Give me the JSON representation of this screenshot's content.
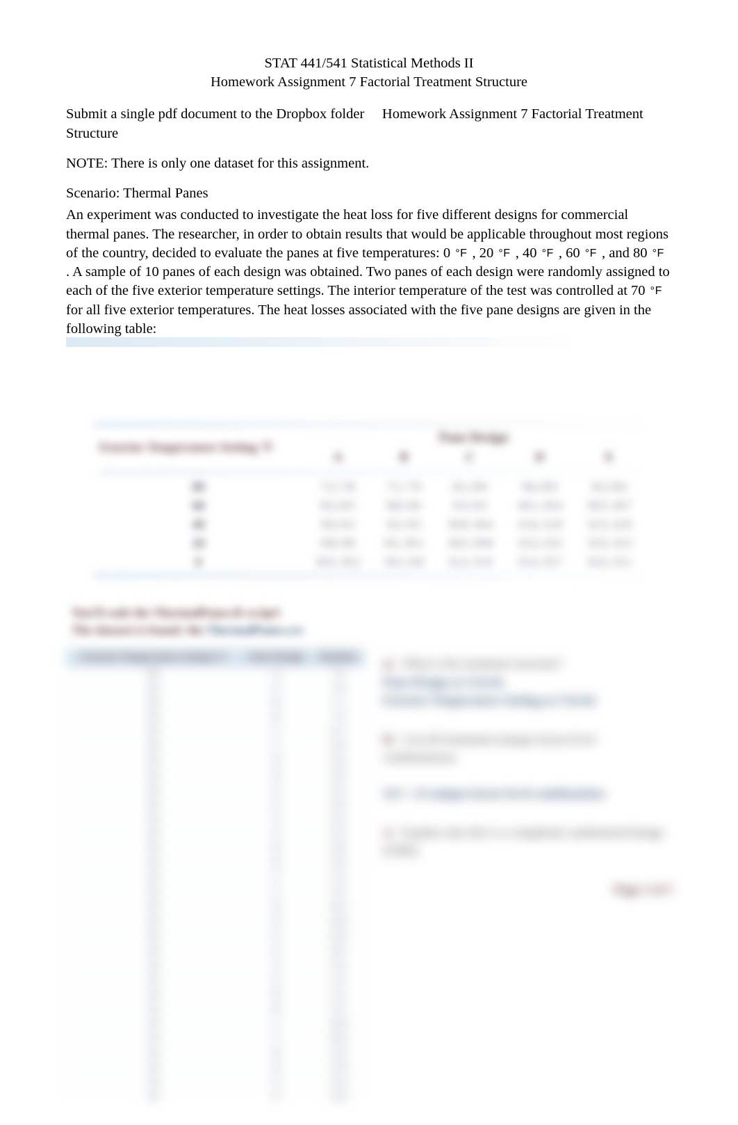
{
  "header": {
    "line1": "STAT 441/541 Statistical Methods II",
    "line2": "Homework Assignment 7 Factorial Treatment Structure"
  },
  "submit_para": {
    "prefix": "Submit a single pdf document to the Dropbox folder ",
    "folder": "Homework Assignment 7 Factorial Treatment Structure"
  },
  "note_line": "NOTE: There is only one dataset for this assignment.",
  "scenario_title": "Scenario: Thermal Panes",
  "scenario_body": {
    "seg1": "An experiment was conducted to investigate the heat loss for five different designs for commercial thermal panes.  The researcher, in order to obtain results that would be applicable throughout most regions of the country, decided to evaluate the panes at five temperatures: 0 ",
    "unit1": "°F",
    "seg2": " , 20 ",
    "unit2": "°F",
    "seg3": " , 40 ",
    "unit3": "°F",
    "seg4": " , 60 ",
    "unit4": "°F",
    "seg5": " , and 80 ",
    "unit5": "°F",
    "seg6": " . A sample of 10 panes of each design was obtained.   Two panes of each design were randomly assigned to each of the five exterior temperature settings.  The interior temperature of the test was controlled at 70 ",
    "unit6": "°F",
    "seg7": "  for all five exterior temperatures.  The heat losses associated with the five pane designs are given in the following table:"
  },
  "data_table": {
    "group_header": "Pane Design",
    "row_header": "Exterior Temperature Setting °F",
    "cols": [
      "A",
      "B",
      "C",
      "D",
      "E"
    ],
    "rows": [
      {
        "t": "80",
        "v": [
          "7.2, 7.8",
          "7.1, 7.9",
          "8.1, 8.0",
          "8.6, 8.9",
          "8.2, 8.0"
        ]
      },
      {
        "t": "60",
        "v": [
          "8.3, 8.5",
          "8.8, 9.0",
          "9.3, 9.5",
          "10.1, 10.4",
          "10.5, 10.7"
        ]
      },
      {
        "t": "40",
        "v": [
          "9.0, 9.2",
          "9.2, 9.5",
          "10.0, 10.4",
          "11.6, 11.8",
          "12.3, 12.0"
        ]
      },
      {
        "t": "20",
        "v": [
          "9.8, 9.8",
          "9.5, 10.1",
          "10.5, 10.8",
          "13.3, 13.5",
          "13.5, 13.3"
        ]
      },
      {
        "t": "0",
        "v": [
          "10.5, 10.2",
          "10.1, 9.9",
          "11.2, 11.0",
          "15.3, 15.7",
          "15.5, 15.1"
        ]
      }
    ]
  },
  "notes": {
    "line1a": "You'll code the ThermalPanes.R script!",
    "line2a": "The dataset is found: the ",
    "line2b": "ThermalPanes.csv"
  },
  "long_table": {
    "headers": [
      "Exterior Temperature Setting °F",
      "Pane Design",
      "Heatloss"
    ],
    "rows": [
      [
        "80",
        "A",
        "7.2"
      ],
      [
        "80",
        "A",
        "7.8"
      ],
      [
        "80",
        "B",
        "7.1"
      ],
      [
        "80",
        "B",
        "7.9"
      ],
      [
        "80",
        "C",
        "8.1"
      ],
      [
        "80",
        "C",
        "8.0"
      ],
      [
        "80",
        "D",
        "8.6"
      ],
      [
        "80",
        "D",
        "8.9"
      ],
      [
        "80",
        "E",
        "8.2"
      ],
      [
        "80",
        "E",
        "8.0"
      ],
      [
        "60",
        "A",
        "8.3"
      ],
      [
        "60",
        "A",
        "8.5"
      ],
      [
        "60",
        "B",
        "8.8"
      ],
      [
        "60",
        "B",
        "9.0"
      ],
      [
        "60",
        "C",
        "9.3"
      ],
      [
        "60",
        "C",
        "9.5"
      ],
      [
        "60",
        "D",
        "10.1"
      ],
      [
        "60",
        "D",
        "10.4"
      ],
      [
        "60",
        "E",
        "10.5"
      ],
      [
        "60",
        "E",
        "10.7"
      ],
      [
        "40",
        "A",
        "9.0"
      ],
      [
        "40",
        "A",
        "9.2"
      ],
      [
        "40",
        "B",
        "9.2"
      ],
      [
        "40",
        "B",
        "9.5"
      ],
      [
        "40",
        "C",
        "10.0"
      ],
      [
        "40",
        "C",
        "10.4"
      ],
      [
        "40",
        "D",
        "11.6"
      ],
      [
        "40",
        "D",
        "11.8"
      ],
      [
        "40",
        "E",
        "12.3"
      ],
      [
        "40",
        "E",
        "12.0"
      ]
    ]
  },
  "questions": {
    "a": {
      "num": "a)",
      "text": "What is the treatment structure?",
      "ans_l1": "Pane Design at 5 levels",
      "ans_l2": "Exterior Temperature Setting at 5 levels"
    },
    "b": {
      "num": "b)",
      "text": "List all treatments (unique factor-level combinations).",
      "ans_l1": "5x5 = 25 unique factor-level combinations"
    },
    "c": {
      "num": "c)",
      "text": "Explain why this is a completely randomized design (CRD)."
    }
  },
  "page_label": "Page 1 of 3"
}
